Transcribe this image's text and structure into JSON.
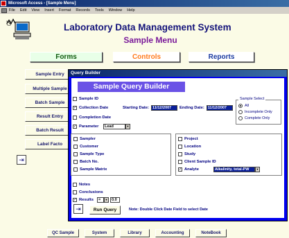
{
  "window": {
    "title": "Microsoft Access - [Sample Menu]"
  },
  "menu": [
    "File",
    "Edit",
    "View",
    "Insert",
    "Format",
    "Records",
    "Tools",
    "Window",
    "Help"
  ],
  "header": {
    "title": "Laboratory Data Management System",
    "subtitle": "Sample Menu"
  },
  "tabs": {
    "forms": "Forms",
    "controls": "Controls",
    "reports": "Reports"
  },
  "side_buttons": [
    "Sample Entry",
    "Multiple Sample",
    "Batch Sample",
    "Result Entry",
    "Batch Result",
    "Label Facto"
  ],
  "bottom_buttons": [
    "QC Sample",
    "System",
    "Library",
    "Accounting",
    "NoteBook"
  ],
  "dialog": {
    "title": "Query Builder",
    "heading": "Sample Query Builder",
    "sample_id": "Sample ID",
    "collection_date": "Collection Date",
    "starting_date_label": "Starting Date:",
    "starting_date": "11/12/2007",
    "ending_date_label": "Ending Date:",
    "ending_date": "11/12/2007",
    "completion_date": "Completion Date",
    "parameter": "Parameter",
    "parameter_value": "Lead",
    "sample_select": {
      "title": "Sample Select",
      "options": [
        "All",
        "Incomplete Only",
        "Complete Only"
      ],
      "selected": "All"
    },
    "left_group": [
      "Sampler",
      "Customer",
      "Sample Type",
      "Batch No.",
      "Sample Matrix"
    ],
    "right_group": [
      "Project",
      "Location",
      "Study",
      "Client Sample ID",
      "Analyte"
    ],
    "analyte_value": "Alkalinity, total-PW",
    "notes": "Notes",
    "conclusions": "Conclusions",
    "results": "Results",
    "results_operator": "=",
    "results_value": "0.0",
    "run_query": "Run Query",
    "note": "Note: Double Click Date Field to select Date"
  }
}
